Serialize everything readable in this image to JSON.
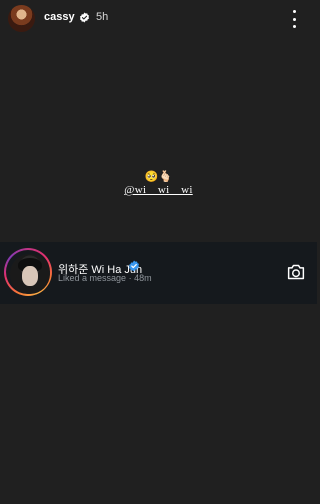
{
  "story": {
    "username": "cassy",
    "time": "5h",
    "emojis": "🥺🫰🏻",
    "mention": "@wi__wi__wi"
  },
  "activity": {
    "name": "위하준 Wi Ha Jun",
    "action": "Liked a message",
    "separator": "·",
    "time": "48m"
  },
  "colors": {
    "background": "#202020",
    "activity_bg": "#15191d",
    "verified": "#3897f0"
  },
  "icons": [
    "verified-icon",
    "more-icon",
    "camera-icon"
  ]
}
